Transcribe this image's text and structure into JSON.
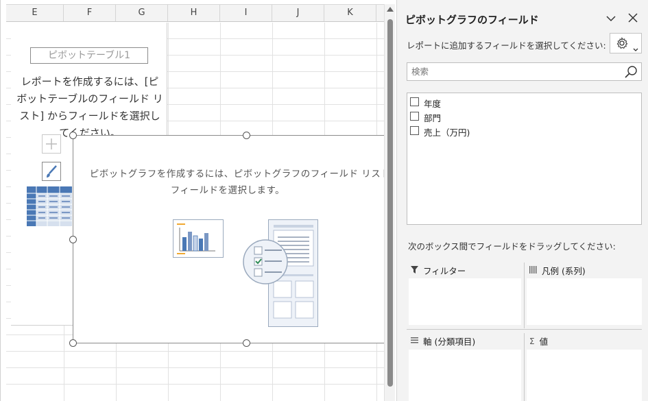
{
  "sheet": {
    "columns": [
      "E",
      "F",
      "G",
      "H",
      "I",
      "J",
      "K"
    ],
    "pivot_table": {
      "name": "ピボットテーブル1",
      "instruction_lines": [
        "レポートを作成するには、[ピ",
        "ボットテーブルのフィールド リ",
        "スト] からフィールドを選択し",
        "てください。"
      ]
    },
    "pivot_chart": {
      "instruction_lines": [
        "ピボットグラフを作成するには、ピボットグラフのフィールド リスト",
        "フィールドを選択します。"
      ]
    }
  },
  "pane": {
    "title": "ピボットグラフのフィールド",
    "subtitle": "レポートに追加するフィールドを選択してください:",
    "search_placeholder": "検索",
    "fields": [
      {
        "label": "年度",
        "checked": false
      },
      {
        "label": "部門",
        "checked": false
      },
      {
        "label": "売上（万円)",
        "checked": false
      }
    ],
    "drag_hint": "次のボックス間でフィールドをドラッグしてください:",
    "areas": {
      "filter": "フィルター",
      "legend": "凡例 (系列)",
      "axis": "軸 (分類項目)",
      "values": "値"
    },
    "icons": {
      "collapse": "chevron-down-icon",
      "close": "close-icon",
      "settings": "gear-icon",
      "search": "search-icon"
    }
  },
  "colors": {
    "accent_blue": "#4a78b5",
    "check_green": "#2e8b57",
    "pane_bg": "#f3f3f3"
  }
}
